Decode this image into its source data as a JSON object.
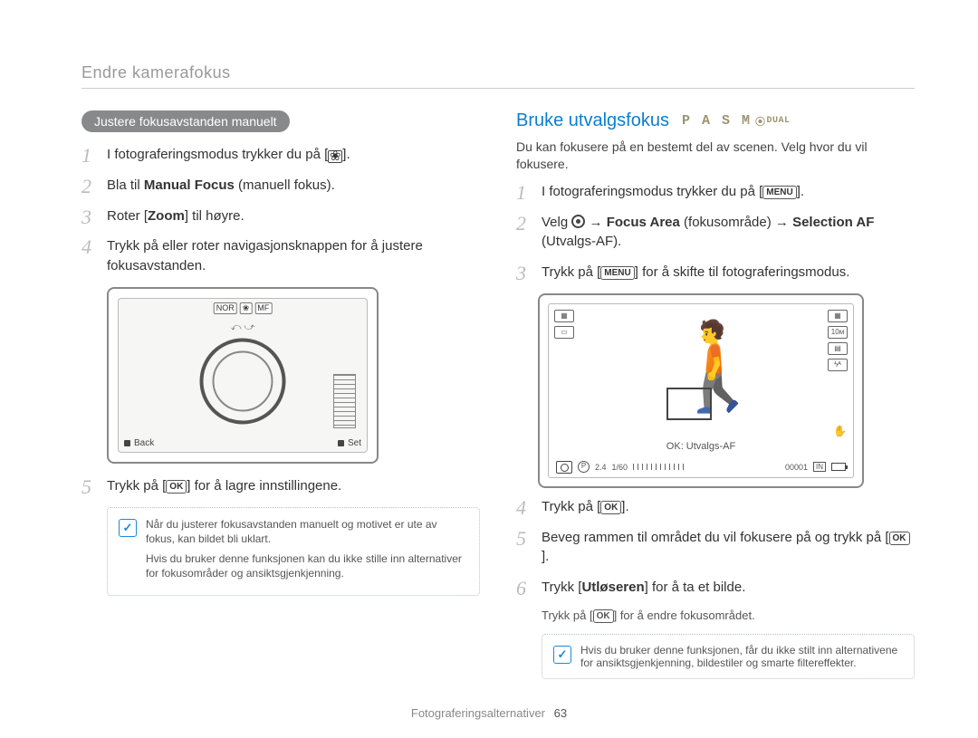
{
  "page_title": "Endre kamerafokus",
  "left": {
    "pill": "Justere fokusavstanden manuelt",
    "steps": {
      "s1_pre": "I fotograferingsmodus trykker du på [",
      "s1_post": "].",
      "s2_pre": "Bla til ",
      "s2_term": "Manual Focus",
      "s2_post": " (manuell fokus).",
      "s3": "Roter [",
      "s3_term": "Zoom",
      "s3_post": "] til høyre.",
      "s4": "Trykk på eller roter navigasjonsknappen for å justere fokusavstanden.",
      "s5_pre": "Trykk på [",
      "s5_btn": "OK",
      "s5_post": "] for å lagre innstillingene."
    },
    "illus": {
      "chips": [
        "NOR",
        "❀",
        "MF"
      ],
      "back": "Back",
      "set": "Set"
    },
    "note": {
      "l1": "Når du justerer fokusavstanden manuelt og motivet er ute av fokus, kan bildet bli uklart.",
      "l2": "Hvis du bruker denne funksjonen kan du ikke stille inn alternativer for fokusområder og ansiktsgjenkjenning."
    }
  },
  "right": {
    "heading": "Bruke utvalgsfokus",
    "modes": "P A S M",
    "modes_tail": "DUAL",
    "intro": "Du kan fokusere på en bestemt del av scenen. Velg hvor du vil fokusere.",
    "steps": {
      "s1_pre": "I fotograferingsmodus trykker du på [",
      "s1_btn": "MENU",
      "s1_post": "].",
      "s2_pre": "Velg ",
      "s2_arrow1": " → ",
      "s2_term": "Focus Area",
      "s2_paren": " (fokusområde) ",
      "s2_arrow2": "→ ",
      "s2_term2": "Selection AF",
      "s2_post": " (Utvalgs-AF).",
      "s3_pre": "Trykk på [",
      "s3_btn": "MENU",
      "s3_post": "] for å skifte til fotograferingsmodus.",
      "hint": "OK: Utvalgs-AF",
      "status": {
        "f": "2.4",
        "sh": "1/60",
        "counter": "00001",
        "mem": "IN"
      },
      "s4_pre": "Trykk på [",
      "s4_btn": "OK",
      "s4_post": "].",
      "s5_pre": "Beveg rammen til området du vil fokusere på og trykk på [",
      "s5_btn": "OK",
      "s5_post": "].",
      "s6_pre": "Trykk [",
      "s6_term": "Utløseren",
      "s6_post": "] for å ta et bilde.",
      "sub_pre": "Trykk på [",
      "sub_btn": "OK",
      "sub_post": "] for å endre fokusområdet."
    },
    "note": "Hvis du bruker denne funksjonen, får du ikke stilt inn alternativene for ansiktsgjenkjenning, bildestiler og smarte filtereffekter."
  },
  "footer": {
    "section": "Fotograferingsalternativer",
    "page": "63"
  }
}
